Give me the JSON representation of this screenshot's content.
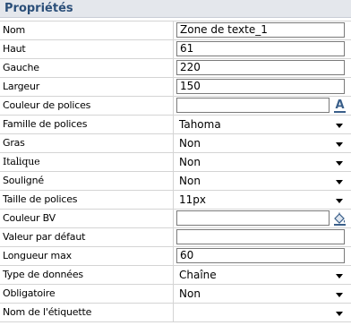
{
  "panel": {
    "title": "Propriétés"
  },
  "rows": {
    "nom": {
      "label": "Nom",
      "value": "Zone de texte_1"
    },
    "haut": {
      "label": "Haut",
      "value": "61"
    },
    "gauche": {
      "label": "Gauche",
      "value": "220"
    },
    "largeur": {
      "label": "Largeur",
      "value": "150"
    },
    "couleur_police": {
      "label": "Couleur de polices",
      "value": ""
    },
    "famille_police": {
      "label": "Famille de polices",
      "value": "Tahoma"
    },
    "gras": {
      "label": "Gras",
      "value": "Non"
    },
    "italique": {
      "label": "Italique",
      "value": "Non"
    },
    "souligne": {
      "label": "Souligné",
      "value": "Non"
    },
    "taille_police": {
      "label": "Taille de polices",
      "value": "11px"
    },
    "couleur_bv": {
      "label": "Couleur BV",
      "value": ""
    },
    "valeur_defaut": {
      "label": "Valeur par défaut",
      "value": ""
    },
    "longueur_max": {
      "label": "Longueur max",
      "value": "60"
    },
    "type_donnees": {
      "label": "Type de données",
      "value": "Chaîne"
    },
    "obligatoire": {
      "label": "Obligatoire",
      "value": "Non"
    },
    "nom_etiquette": {
      "label": "Nom de l'étiquette",
      "value": ""
    }
  },
  "icons": {
    "font_color": "font-color-icon",
    "fill_color": "paint-bucket-icon",
    "dropdown": "chevron-down-icon"
  },
  "colors": {
    "title_text": "#2b4f79",
    "title_bg": "#e4e7ec",
    "grid_line": "#d4d4d4"
  }
}
